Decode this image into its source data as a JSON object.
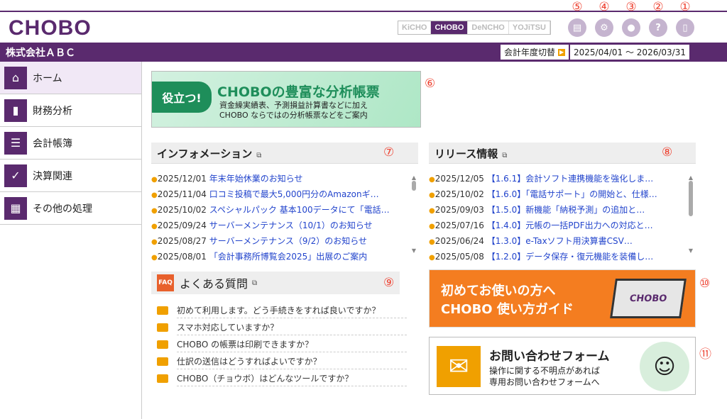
{
  "header": {
    "logo": "CHOBO",
    "apps": [
      "KiCHO",
      "CHOBO",
      "DeNCHO",
      "YOJiTSU"
    ],
    "active_app": "CHOBO",
    "icons": [
      "document-icon",
      "gear-icon",
      "user-settings-icon",
      "help-icon",
      "logout-icon"
    ],
    "markers": [
      "⑤",
      "④",
      "③",
      "②",
      "①"
    ]
  },
  "navbar": {
    "company": "株式会社ＡＢＣ",
    "fiscal_switch": "会計年度切替",
    "period": "2025/04/01 ～ 2026/03/31"
  },
  "sidebar": {
    "items": [
      {
        "label": "ホーム",
        "icon": "home-icon"
      },
      {
        "label": "財務分析",
        "icon": "bar-chart-icon"
      },
      {
        "label": "会計帳簿",
        "icon": "ledger-icon"
      },
      {
        "label": "決算関連",
        "icon": "settlement-icon"
      },
      {
        "label": "その他の処理",
        "icon": "keyboard-icon"
      }
    ]
  },
  "banner": {
    "tag": "役立つ!",
    "title": "CHOBOの豊富な分析帳票",
    "sub1": "資金繰実績表、予測損益計算書などに加え",
    "sub2": "CHOBO ならではの分析帳票などをご案内",
    "marker": "⑥"
  },
  "info": {
    "title": "インフォメーション",
    "marker": "⑦",
    "items": [
      {
        "date": "2025/12/01",
        "title": "年末年始休業のお知らせ"
      },
      {
        "date": "2025/11/04",
        "title": "口コミ投稿で最大5,000円分のAmazonギ…"
      },
      {
        "date": "2025/10/02",
        "title": "スペシャルパック 基本100データにて「電話…"
      },
      {
        "date": "2025/09/24",
        "title": "サーバーメンテナンス（10/1）のお知らせ"
      },
      {
        "date": "2025/08/27",
        "title": "サーバーメンテナンス（9/2）のお知らせ"
      },
      {
        "date": "2025/08/01",
        "title": "「会計事務所博覧会2025」出展のご案内"
      }
    ]
  },
  "release": {
    "title": "リリース情報",
    "marker": "⑧",
    "items": [
      {
        "date": "2025/12/05",
        "title": "【1.6.1】会計ソフト連携機能を強化しま…"
      },
      {
        "date": "2025/10/02",
        "title": "【1.6.0】「電話サポート」の開始と、仕様…"
      },
      {
        "date": "2025/09/03",
        "title": "【1.5.0】新機能「納税予測」の追加と…"
      },
      {
        "date": "2025/07/16",
        "title": "【1.4.0】元帳の一括PDF出力への対応と…"
      },
      {
        "date": "2025/06/24",
        "title": "【1.3.0】e-Taxソフト用決算書CSV…"
      },
      {
        "date": "2025/05/08",
        "title": "【1.2.0】データ保存・復元機能を装備し…"
      }
    ]
  },
  "faq": {
    "icon_text": "FAQ",
    "title": "よくある質問",
    "marker": "⑨",
    "items": [
      "初めて利用します。どう手続きをすれば良いですか？",
      "スマホ対応していますか？",
      "CHOBO の帳票は印刷できますか？",
      "仕訳の送信はどうすればよいですか？",
      "CHOBO（チョウボ）はどんなツールですか？"
    ]
  },
  "guide": {
    "line1": "初めてお使いの方へ",
    "line2": "CHOBO 使い方ガイド",
    "laptop": "CHOBO",
    "marker": "⑩"
  },
  "contact": {
    "title": "お問い合わせフォーム",
    "sub1": "操作に関する不明点があれば",
    "sub2": "専用お問い合わせフォームへ",
    "marker": "⑪"
  }
}
